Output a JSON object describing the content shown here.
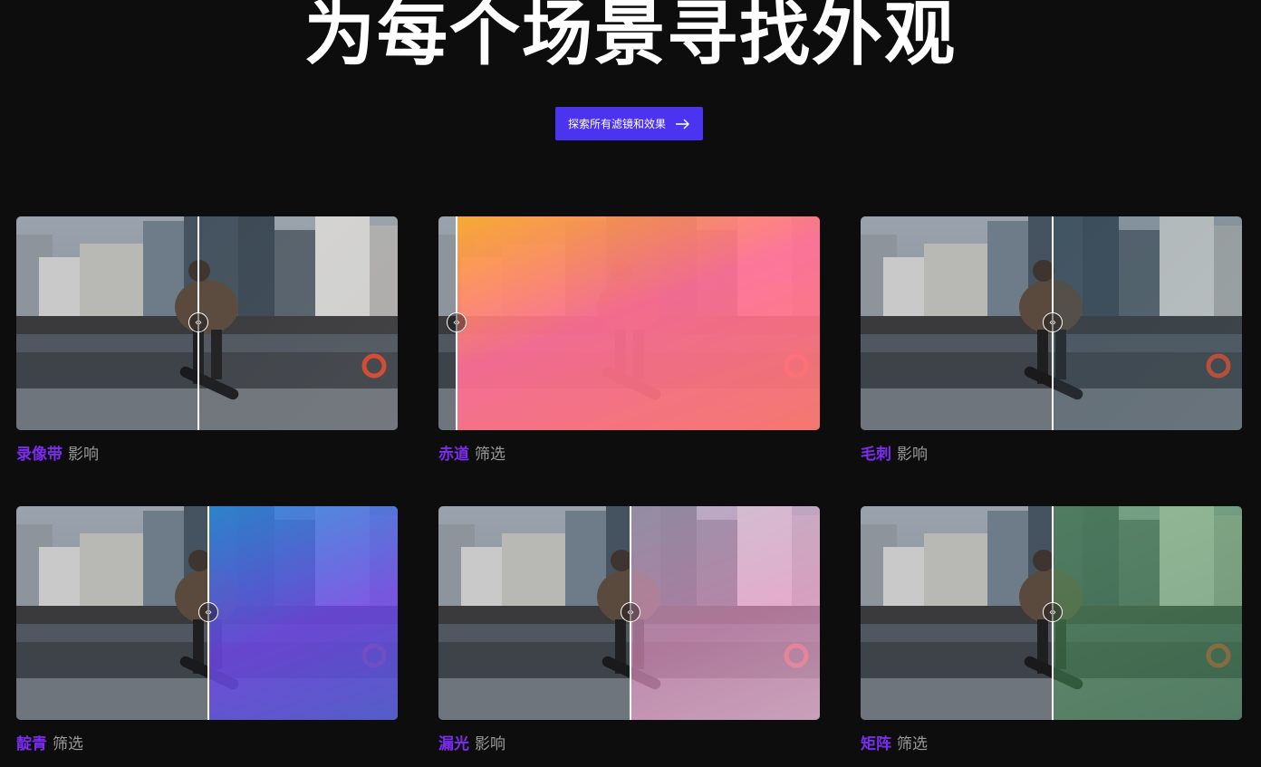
{
  "hero": {
    "title": "为每个场景寻找外观",
    "cta_label": "探索所有滤镜和效果"
  },
  "cards": [
    {
      "name": "录像带",
      "kind": "影响",
      "overlay": "linear-gradient(135deg, rgba(190,190,200,0.0), rgba(160,150,150,0.1))",
      "split_fraction": 0.475
    },
    {
      "name": "赤道",
      "kind": "筛选",
      "overlay": "linear-gradient(160deg, rgba(255,170,40,0.92) 0%, rgba(255,110,150,0.92) 45%, rgba(255,120,110,0.92) 100%)",
      "split_fraction": 0.045
    },
    {
      "name": "毛刺",
      "kind": "影响",
      "overlay": "linear-gradient(135deg, rgba(60,90,110,0.25), rgba(80,110,120,0.2))",
      "split_fraction": 0.5
    },
    {
      "name": "靛青",
      "kind": "筛选",
      "overlay": "linear-gradient(160deg, rgba(40,140,220,0.85) 0%, rgba(110,70,230,0.85) 55%, rgba(80,90,210,0.88) 100%)",
      "split_fraction": 0.5
    },
    {
      "name": "漏光",
      "kind": "影响",
      "overlay": "linear-gradient(160deg, rgba(200,180,210,0.6) 0%, rgba(235,150,200,0.65) 55%, rgba(230,175,205,0.75) 100%)",
      "split_fraction": 0.5
    },
    {
      "name": "矩阵",
      "kind": "筛选",
      "overlay": "linear-gradient(160deg, rgba(90,160,100,0.55) 0%, rgba(60,130,80,0.55) 100%)",
      "split_fraction": 0.5
    }
  ]
}
